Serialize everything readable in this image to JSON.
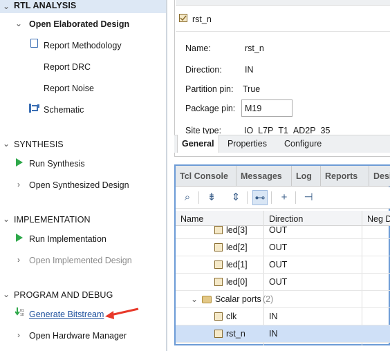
{
  "flow": {
    "rtl_header": "RTL ANALYSIS",
    "rtl_items": {
      "open_elaborated": "Open Elaborated Design",
      "report_methodology": "Report Methodology",
      "report_drc": "Report DRC",
      "report_noise": "Report Noise",
      "schematic": "Schematic"
    },
    "synthesis_header": "SYNTHESIS",
    "synthesis_items": {
      "run": "Run Synthesis",
      "open": "Open Synthesized Design"
    },
    "implementation_header": "IMPLEMENTATION",
    "implementation_items": {
      "run": "Run Implementation",
      "open": "Open Implemented Design"
    },
    "program_header": "PROGRAM AND DEBUG",
    "program_items": {
      "generate": "Generate Bitstream",
      "hardware": "Open Hardware Manager"
    }
  },
  "properties": {
    "object_name": "rst_n",
    "fields": {
      "name_label": "Name:",
      "name_value": "rst_n",
      "direction_label": "Direction:",
      "direction_value": "IN",
      "partition_label": "Partition pin:",
      "partition_value": "True",
      "package_label": "Package pin:",
      "package_value": "M19",
      "site_label": "Site type:",
      "site_value": "IO_L7P_T1_AD2P_35"
    },
    "tabs": {
      "general": "General",
      "properties": "Properties",
      "configure": "Configure"
    }
  },
  "console": {
    "tabs": {
      "tcl": "Tcl Console",
      "messages": "Messages",
      "log": "Log",
      "reports": "Reports",
      "design": "Desi"
    },
    "columns": {
      "name": "Name",
      "direction": "Direction",
      "neg": "Neg D"
    },
    "rows": [
      {
        "name": "led[3]",
        "direction": "OUT"
      },
      {
        "name": "led[2]",
        "direction": "OUT"
      },
      {
        "name": "led[1]",
        "direction": "OUT"
      },
      {
        "name": "led[0]",
        "direction": "OUT"
      }
    ],
    "group": {
      "name": "Scalar ports",
      "count": "(2)"
    },
    "scalar_rows": [
      {
        "name": "clk",
        "direction": "IN"
      },
      {
        "name": "rst_n",
        "direction": "IN"
      }
    ]
  },
  "colors": {
    "accent": "#6c9bd6",
    "run_green": "#2ea84a",
    "annotation_arrow": "#e8392a",
    "selection": "#cfe0f7"
  }
}
